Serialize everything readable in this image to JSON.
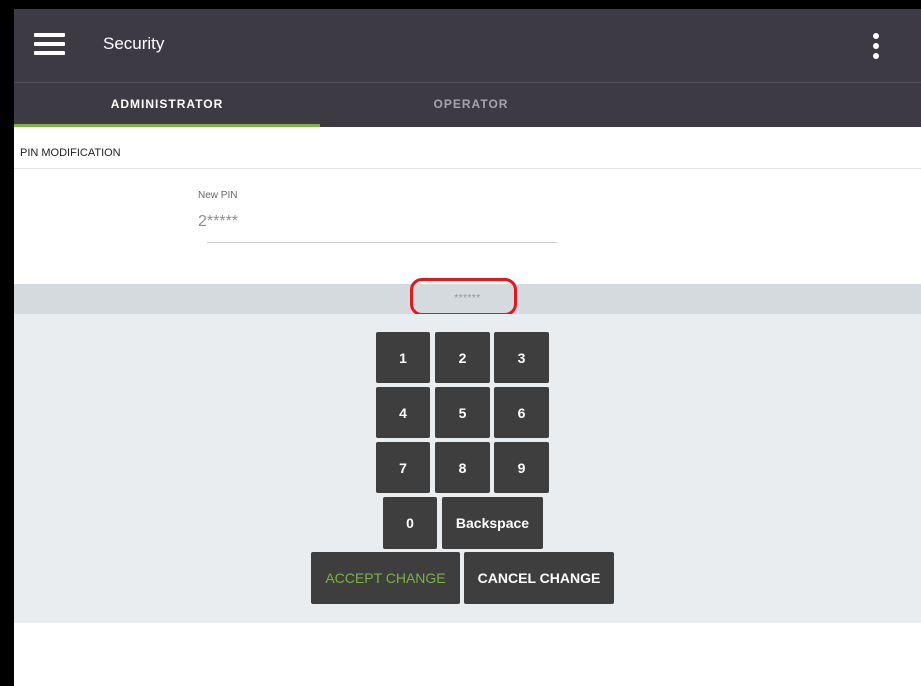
{
  "header": {
    "title": "Security",
    "menu_icon": "hamburger-menu-icon",
    "overflow_icon": "more-vertical-icon"
  },
  "tabs": [
    {
      "label": "ADMINISTRATOR",
      "active": true
    },
    {
      "label": "OPERATOR",
      "active": false
    }
  ],
  "section": {
    "title": "PIN MODIFICATION"
  },
  "pin_field": {
    "label": "New PIN",
    "value": "2*****"
  },
  "pin_display": {
    "value": "******"
  },
  "keypad": {
    "keys": [
      "1",
      "2",
      "3",
      "4",
      "5",
      "6",
      "7",
      "8",
      "9",
      "0"
    ],
    "backspace_label": "Backspace"
  },
  "actions": {
    "accept_label": "ACCEPT CHANGE",
    "cancel_label": "CANCEL CHANGE"
  },
  "colors": {
    "header_bg": "#3d3a43",
    "active_tab_indicator": "#7cb342",
    "accept_text": "#7cb342",
    "key_bg": "#3e3e3e",
    "highlight": "#e4171d"
  }
}
